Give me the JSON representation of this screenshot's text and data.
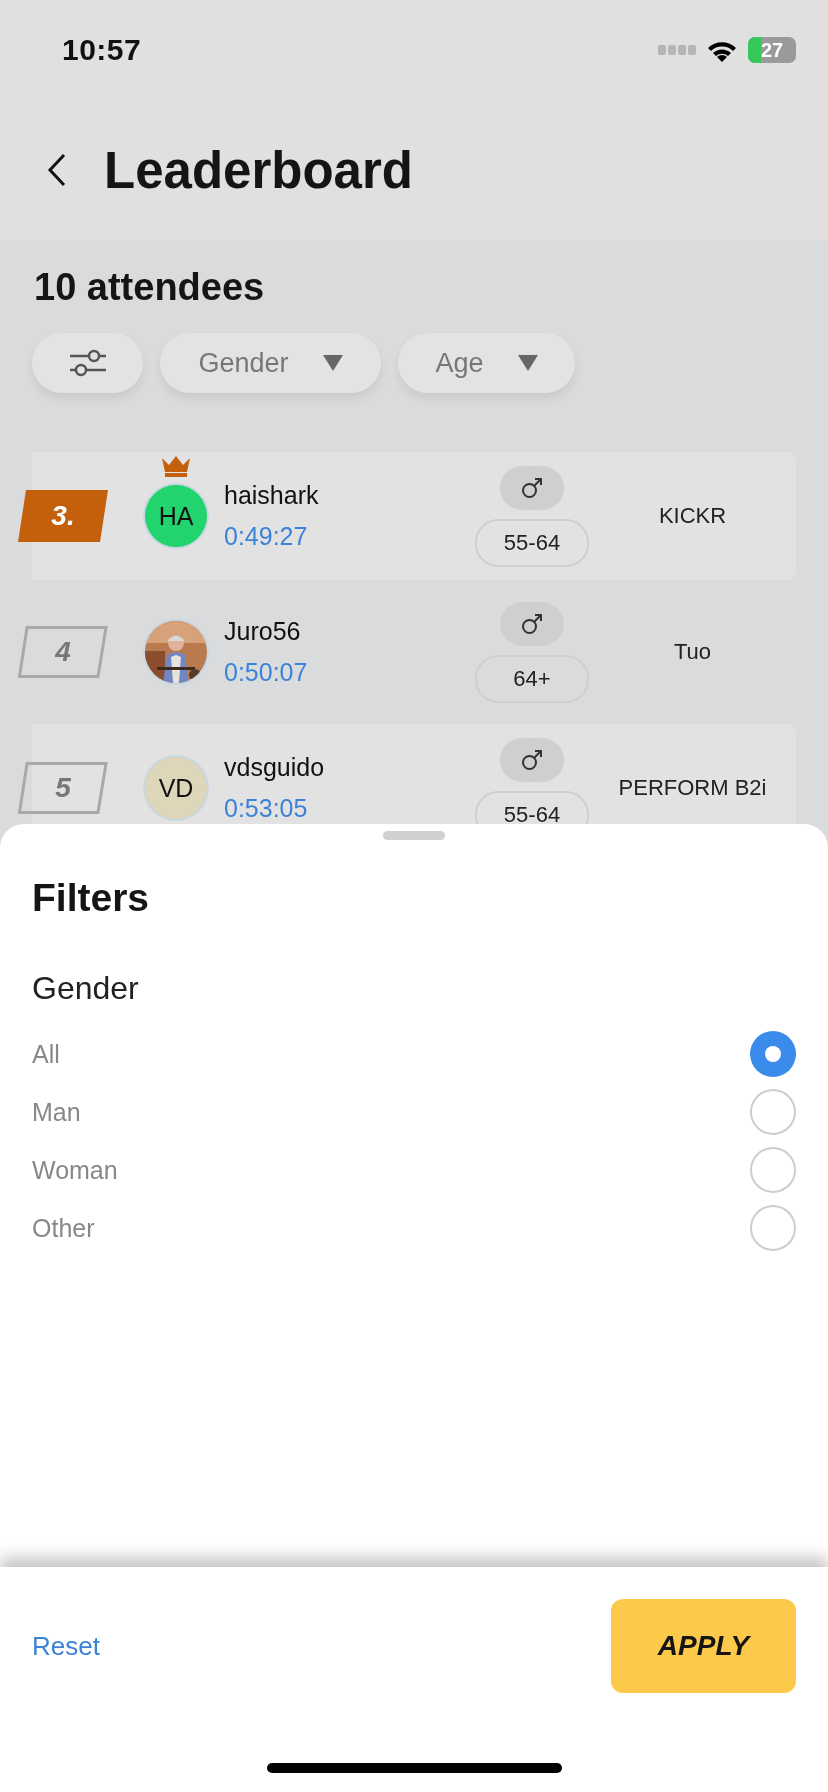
{
  "status_bar": {
    "time": "10:57",
    "battery": "27"
  },
  "header": {
    "title": "Leaderboard"
  },
  "attendees_count": "10 attendees",
  "filter_chips": [
    {
      "label": "Gender"
    },
    {
      "label": "Age"
    }
  ],
  "rows": [
    {
      "rank": "3.",
      "kind": "podium",
      "crown": true,
      "name": "haishark",
      "time": "0:49:27",
      "avatar": {
        "kind": "initials",
        "initials": "HA",
        "color": "#22d46e"
      },
      "age": "55-64",
      "device": "KICKR"
    },
    {
      "rank": "4",
      "kind": "regular",
      "crown": false,
      "name": "Juro56",
      "time": "0:50:07",
      "age": "64+",
      "device": "Tuo"
    },
    {
      "rank": "5",
      "kind": "regular",
      "crown": false,
      "name": "vdsguido",
      "time": "0:53:05",
      "avatar": {
        "kind": "initials",
        "initials": "VD",
        "color": "#ddd6b8"
      },
      "age": "55-64",
      "device": "PERFORM B2i"
    }
  ],
  "sheet": {
    "title": "Filters",
    "section": "Gender",
    "options": [
      {
        "label": "All",
        "selected": true
      },
      {
        "label": "Man",
        "selected": false
      },
      {
        "label": "Woman",
        "selected": false
      },
      {
        "label": "Other",
        "selected": false
      }
    ],
    "reset": "Reset",
    "apply": "APPLY"
  }
}
